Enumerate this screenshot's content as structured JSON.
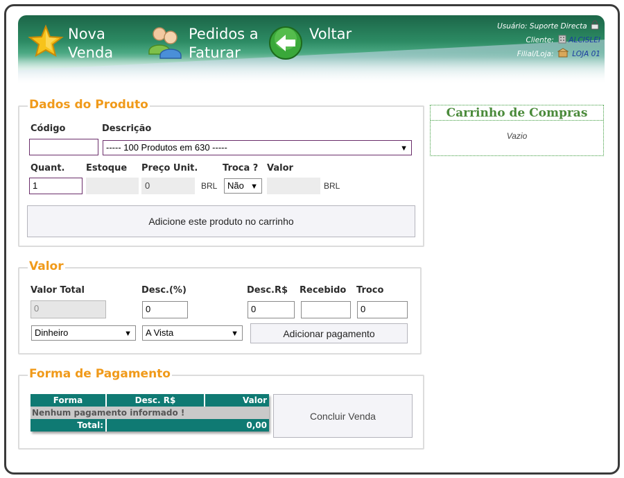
{
  "header": {
    "nav": [
      {
        "line1": "Nova",
        "line2": "Venda"
      },
      {
        "line1": "Pedidos a",
        "line2": "Faturar"
      },
      {
        "line1": "Voltar",
        "line2": ""
      }
    ],
    "user_label": "Usuário:",
    "user_value": "Suporte Directa",
    "client_label": "Cliente:",
    "client_value": "ALCISLEI",
    "store_label": "Filial/Loja:",
    "store_value": "LOJA 01"
  },
  "produto": {
    "legend": "Dados do Produto",
    "codigo_label": "Código",
    "descricao_label": "Descrição",
    "codigo_value": "",
    "descricao_selected": "----- 100 Produtos em 630 -----",
    "quant_label": "Quant.",
    "estoque_label": "Estoque",
    "preco_label": "Preço Unit.",
    "troca_label": "Troca ?",
    "valor_label": "Valor",
    "quant_value": "1",
    "estoque_value": "",
    "preco_value": "0",
    "currency": "BRL",
    "troca_selected": "Não",
    "valor_value": "",
    "add_button": "Adicione este produto no carrinho"
  },
  "cart": {
    "title": "Carrinho de Compras",
    "empty_text": "Vazio"
  },
  "valor": {
    "legend": "Valor",
    "total_label": "Valor Total",
    "desc_pct_label": "Desc.(%)",
    "desc_rs_label": "Desc.R$",
    "recebido_label": "Recebido",
    "troco_label": "Troco",
    "total_value": "0",
    "desc_pct_value": "0",
    "desc_rs_value": "0",
    "recebido_value": "",
    "troco_value": "0",
    "payment_method": "Dinheiro",
    "payment_term": "A Vista",
    "add_payment_button": "Adicionar pagamento"
  },
  "pagamento": {
    "legend": "Forma de Pagamento",
    "columns": [
      "Forma",
      "Desc. R$",
      "Valor"
    ],
    "empty_row": "Nenhum pagamento informado !",
    "total_label": "Total:",
    "total_value": "0,00",
    "conclude_button": "Concluir Venda"
  },
  "colors": {
    "header_green": "#2c8a63",
    "legend_orange": "#f09a1a",
    "table_teal": "#0f7a73",
    "cart_green": "#4a8a3a"
  }
}
